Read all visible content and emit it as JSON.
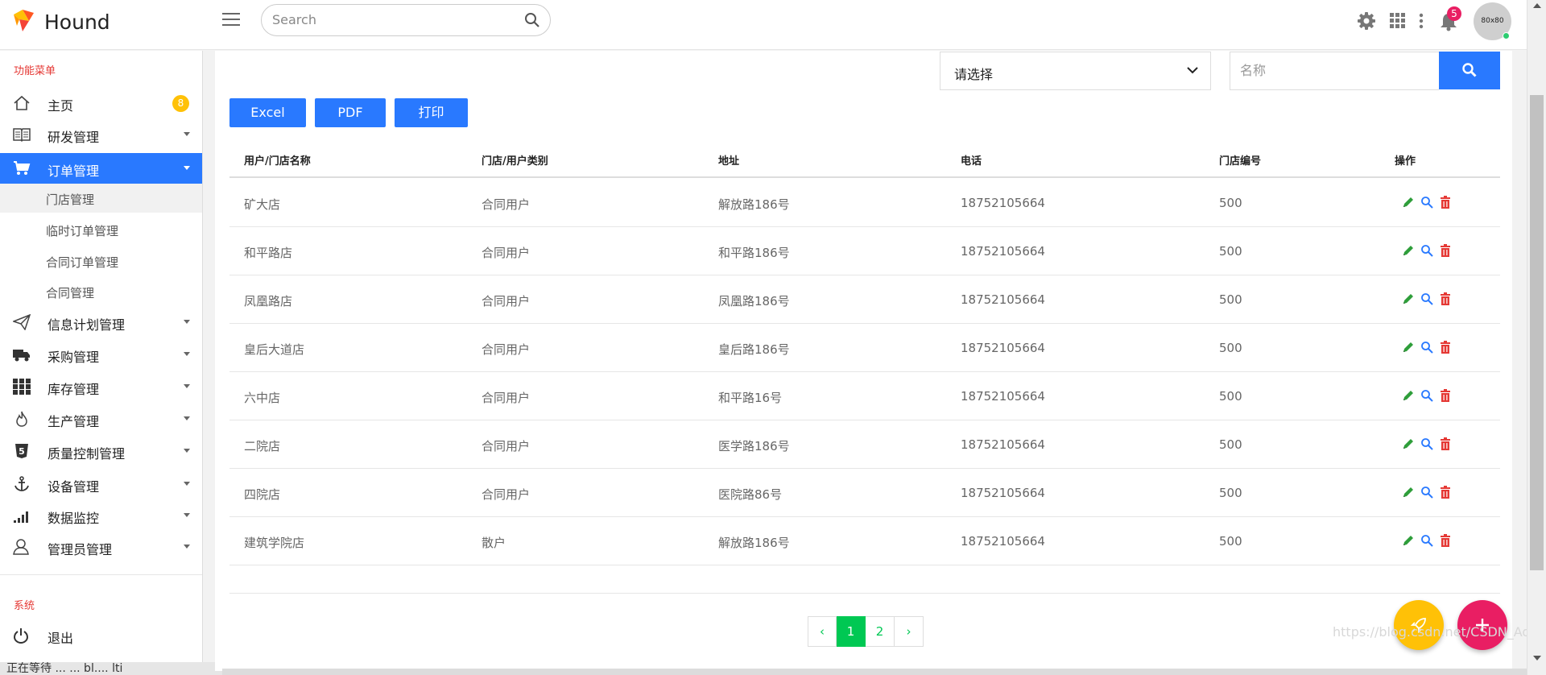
{
  "app": {
    "brand": "Hound"
  },
  "header": {
    "search_placeholder": "Search",
    "notification_count": "5",
    "avatar_text": "80x80"
  },
  "sidebar": {
    "section_main": "功能菜单",
    "items": [
      {
        "label": "主页",
        "icon": "home-icon",
        "badge": "8"
      },
      {
        "label": "研发管理",
        "icon": "book-icon"
      },
      {
        "label": "订单管理",
        "icon": "cart-icon",
        "active": true
      },
      {
        "label": "信息计划管理",
        "icon": "paper-plane-icon"
      },
      {
        "label": "采购管理",
        "icon": "truck-icon"
      },
      {
        "label": "库存管理",
        "icon": "grid-icon"
      },
      {
        "label": "生产管理",
        "icon": "fire-icon"
      },
      {
        "label": "质量控制管理",
        "icon": "html5-icon"
      },
      {
        "label": "设备管理",
        "icon": "anchor-icon"
      },
      {
        "label": "数据监控",
        "icon": "signal-bars-icon"
      },
      {
        "label": "管理员管理",
        "icon": "user-icon"
      }
    ],
    "subitems": [
      "门店管理",
      "临时订单管理",
      "合同订单管理",
      "合同管理"
    ],
    "section_system": "系统",
    "logout": "退出",
    "bottom_text": "正在等待 ... ... bl.... lti"
  },
  "filters": {
    "select_value": "请选择",
    "name_placeholder": "名称"
  },
  "export_buttons": [
    "Excel",
    "PDF",
    "打印"
  ],
  "table": {
    "headers": [
      "用户/门店名称",
      "门店/用户类别",
      "地址",
      "电话",
      "门店编号",
      "操作"
    ],
    "rows": [
      [
        "矿大店",
        "合同用户",
        "解放路186号",
        "18752105664",
        "500"
      ],
      [
        "和平路店",
        "合同用户",
        "和平路186号",
        "18752105664",
        "500"
      ],
      [
        "凤凰路店",
        "合同用户",
        "凤凰路186号",
        "18752105664",
        "500"
      ],
      [
        "皇后大道店",
        "合同用户",
        "皇后路186号",
        "18752105664",
        "500"
      ],
      [
        "六中店",
        "合同用户",
        "和平路16号",
        "18752105664",
        "500"
      ],
      [
        "二院店",
        "合同用户",
        "医学路186号",
        "18752105664",
        "500"
      ],
      [
        "四院店",
        "合同用户",
        "医院路86号",
        "18752105664",
        "500"
      ],
      [
        "建筑学院店",
        "散户",
        "解放路186号",
        "18752105664",
        "500"
      ]
    ]
  },
  "pagination": {
    "prev": "‹",
    "pages": [
      "1",
      "2"
    ],
    "next": "›",
    "current": "1"
  },
  "watermark": "https://blog.csdn.net/CSDN_Admin",
  "colors": {
    "primary": "#2979ff",
    "pager": "#00c853",
    "fab_rocket": "#ffc107",
    "fab_add": "#e91e63"
  }
}
